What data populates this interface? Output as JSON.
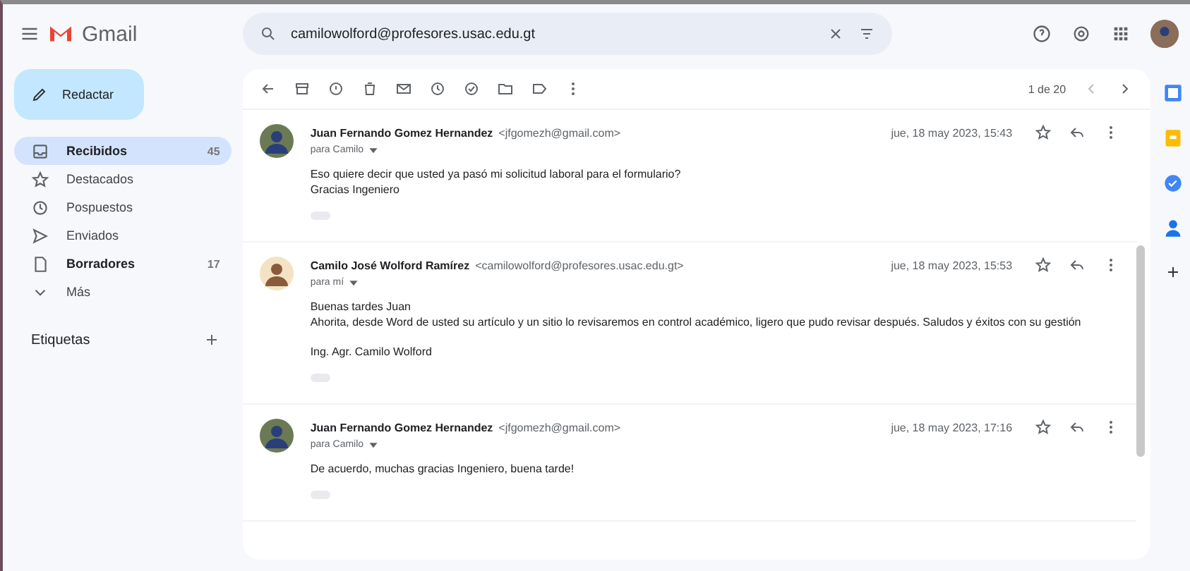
{
  "app": {
    "name": "Gmail"
  },
  "search": {
    "value": "camilowolford@profesores.usac.edu.gt"
  },
  "compose": {
    "label": "Redactar"
  },
  "nav": [
    {
      "label": "Recibidos",
      "count": "45",
      "selected": true,
      "bold": true
    },
    {
      "label": "Destacados",
      "selected": false,
      "bold": false
    },
    {
      "label": "Pospuestos",
      "selected": false,
      "bold": false
    },
    {
      "label": "Enviados",
      "selected": false,
      "bold": false
    },
    {
      "label": "Borradores",
      "count": "17",
      "selected": false,
      "bold": true
    },
    {
      "label": "Más",
      "selected": false,
      "bold": false
    }
  ],
  "labels": {
    "title": "Etiquetas"
  },
  "pager": {
    "text": "1 de 20"
  },
  "messages": [
    {
      "sender": "Juan Fernando Gomez Hernandez",
      "email": "<jfgomezh@gmail.com>",
      "to": "para Camilo",
      "date": "jue, 18 may 2023, 15:43",
      "lines": [
        "Eso quiere decir que usted ya pasó mi solicitud laboral para el formulario?",
        "Gracias Ingeniero"
      ],
      "starred": false
    },
    {
      "sender": "Camilo José Wolford Ramírez",
      "email": "<camilowolford@profesores.usac.edu.gt>",
      "to": "para mí",
      "date": "jue, 18 may 2023, 15:53",
      "lines": [
        "Buenas tardes Juan",
        "Ahorita, desde Word de usted su artículo y un sitio lo revisaremos en control académico, ligero que pudo revisar después. Saludos y éxitos con su gestión"
      ],
      "signature": "Ing. Agr. Camilo Wolford",
      "starred": false
    },
    {
      "sender": "Juan Fernando Gomez Hernandez",
      "email": "<jfgomezh@gmail.com>",
      "to": "para Camilo",
      "date": "jue, 18 may 2023, 17:16",
      "lines": [
        "De acuerdo, muchas gracias Ingeniero, buena tarde!"
      ],
      "starred": false
    }
  ]
}
